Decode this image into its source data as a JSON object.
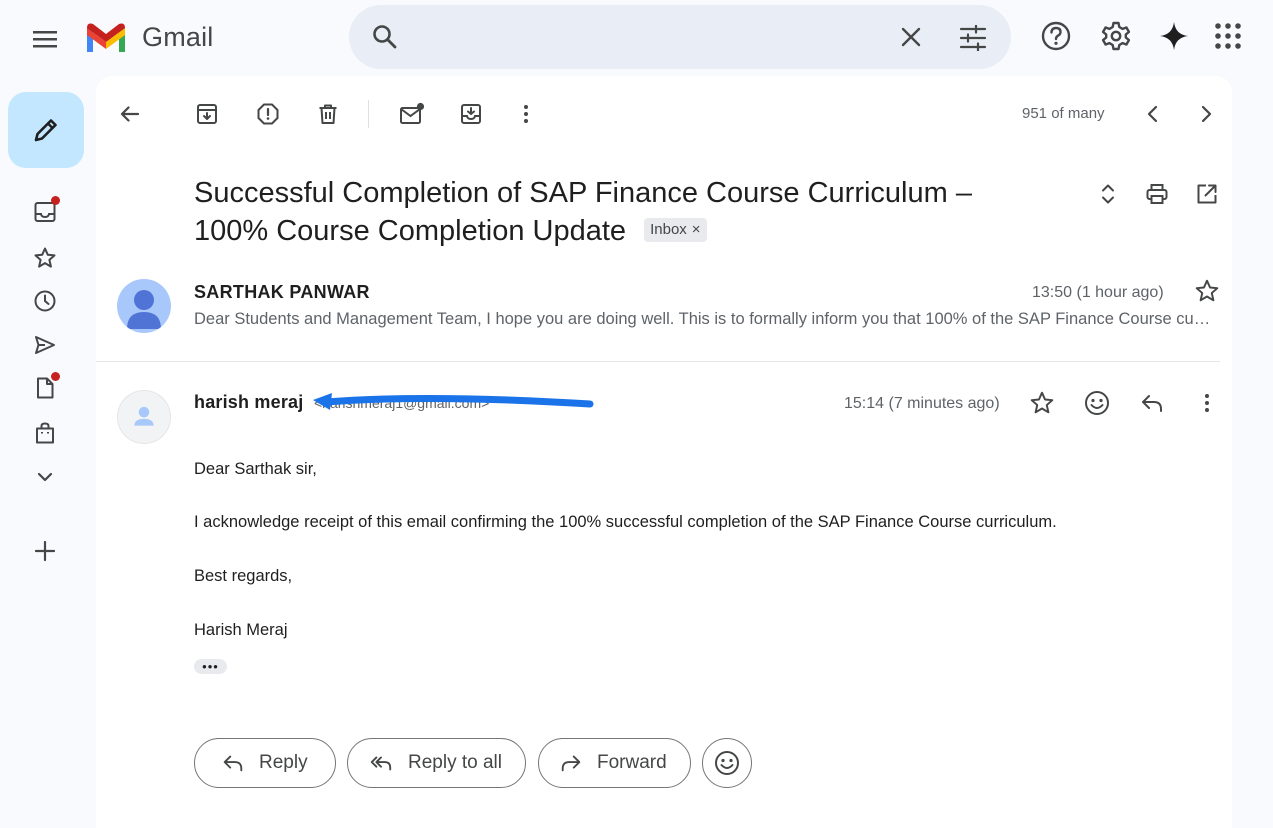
{
  "app": {
    "name": "Gmail",
    "colors": {
      "accent": "#c2e7ff",
      "badge": "#c5221f",
      "search_bg": "#e9eef6",
      "annotation_arrow": "#1a73e8"
    }
  },
  "search": {
    "placeholder": "",
    "value": ""
  },
  "toolbar": {
    "pager": "951 of many"
  },
  "sidebar": {
    "items": [
      {
        "icon": "inbox-icon",
        "badge": true
      },
      {
        "icon": "star-icon",
        "badge": false
      },
      {
        "icon": "clock-icon",
        "badge": false
      },
      {
        "icon": "send-icon",
        "badge": false
      },
      {
        "icon": "draft-icon",
        "badge": true
      },
      {
        "icon": "bag-icon",
        "badge": false
      },
      {
        "icon": "chevron-down-icon",
        "badge": false
      },
      {
        "icon": "plus-icon",
        "badge": false
      }
    ]
  },
  "thread": {
    "subject": "Successful Completion of SAP Finance Course Curriculum – 100% Course Completion Update",
    "label": "Inbox",
    "label_close": "×"
  },
  "messages": [
    {
      "sender": "SARTHAK PANWAR",
      "time": "13:50 (1 hour ago)",
      "snippet": "Dear Students and Management Team, I hope you are doing well. This is to formally inform you that 100% of the SAP Finance Course curriculum has been successfully completed."
    },
    {
      "sender": "harish meraj",
      "email": "<harishmeraj1@gmail.com>",
      "time": "15:14 (7 minutes ago)",
      "body": [
        "Dear Sarthak sir,",
        "I acknowledge receipt of this email confirming the 100% successful completion of the SAP Finance Course curriculum.",
        "Best regards,",
        "Harish Meraj"
      ],
      "trimmed": "•••"
    }
  ],
  "actions": {
    "reply": "Reply",
    "reply_all": "Reply to all",
    "forward": "Forward"
  }
}
